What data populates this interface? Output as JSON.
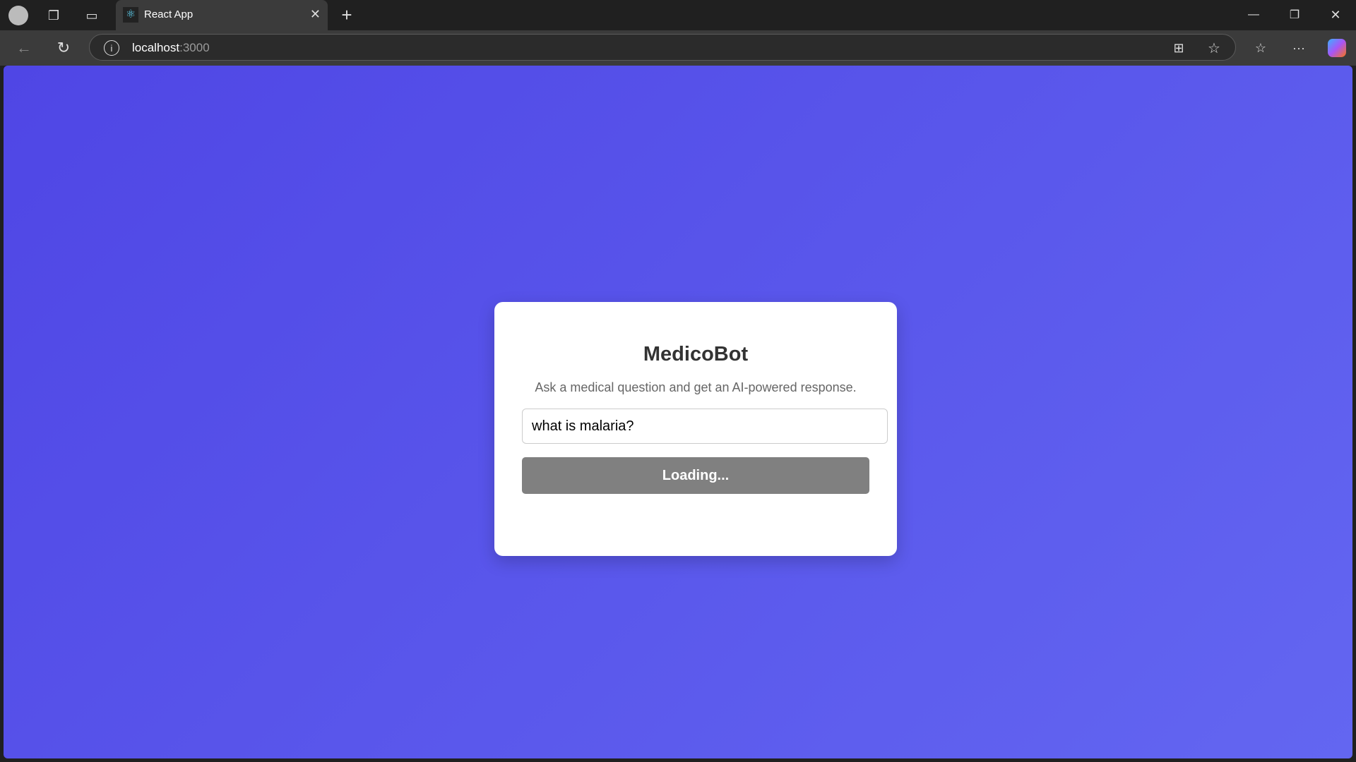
{
  "browser": {
    "tab_title": "React App",
    "url_host": "localhost",
    "url_port": ":3000"
  },
  "app": {
    "title": "MedicoBot",
    "subtitle": "Ask a medical question and get an AI-powered response.",
    "question_value": "what is malaria?",
    "submit_label": "Loading..."
  },
  "colors": {
    "gradient_start": "#4f46e5",
    "gradient_end": "#6366f1",
    "button_disabled": "#808080"
  }
}
